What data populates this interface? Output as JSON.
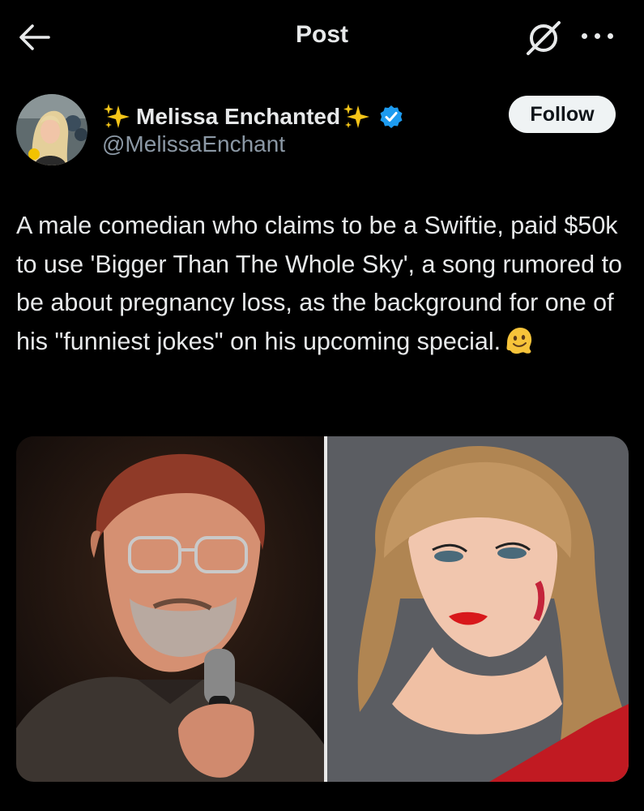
{
  "header": {
    "title": "Post",
    "back_icon": "arrow-left-icon",
    "grok_icon": "grok-icon",
    "more_icon": "more-horizontal-icon"
  },
  "author": {
    "name": "Melissa Enchanted",
    "handle": "@MelissaEnchant",
    "verified": true,
    "verified_color": "#1d9bf0",
    "sparkle_icon": "sparkles-icon",
    "follow_label": "Follow"
  },
  "post": {
    "text": "A male comedian who claims to be a Swiftie, paid $50k to use 'Bigger Than The Whole Sky', a song rumored to be about pregnancy loss, as the background for one of his \"funniest jokes\" on his upcoming special.",
    "emoji": "melting-face-emoji"
  },
  "media": {
    "left_image": "comedian-with-microphone",
    "right_image": "woman-with-red-lipstick"
  },
  "colors": {
    "background": "#000000",
    "text": "#e7e9ea",
    "secondary_text": "#8b98a5",
    "follow_bg": "#eff3f4"
  }
}
